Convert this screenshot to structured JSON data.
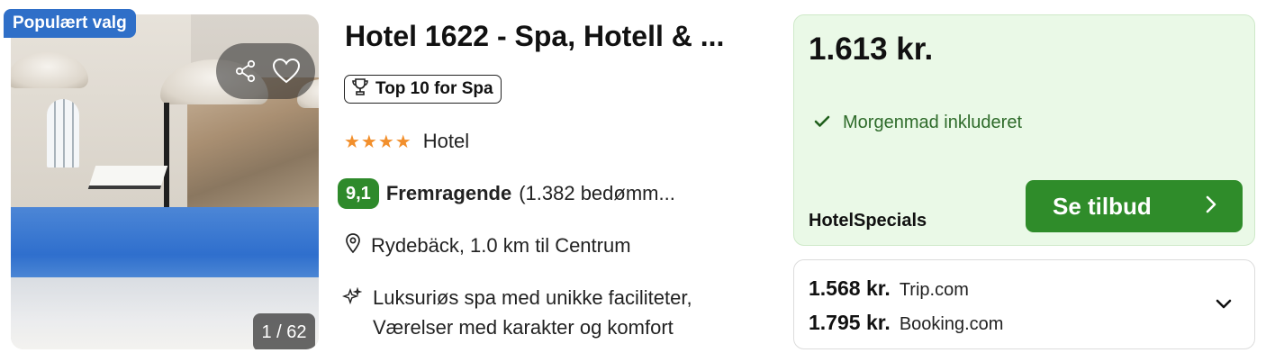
{
  "photo": {
    "badge": "Populært valg",
    "counter": "1 / 62"
  },
  "hotel": {
    "title": "Hotel 1622 - Spa, Hotell & ...",
    "award": "Top 10 for Spa",
    "stars": "★★★★",
    "star_count": 4,
    "type": "Hotel",
    "score": "9,1",
    "rating_word": "Fremragende",
    "reviews": "(1.382 bedømm...",
    "location": "Rydebäck, 1.0 km til Centrum",
    "features_line1": "Luksuriøs spa med unikke faciliteter,",
    "features_line2": "Værelser med karakter og komfort"
  },
  "deal": {
    "price": "1.613 kr.",
    "perk": "Morgenmad inkluderet",
    "provider": "HotelSpecials",
    "cta": "Se tilbud"
  },
  "others": [
    {
      "price": "1.568 kr.",
      "site": "Trip.com"
    },
    {
      "price": "1.795 kr.",
      "site": "Booking.com"
    }
  ],
  "colors": {
    "badge": "#2f6fc8",
    "score": "#2e8a2b",
    "stars": "#f28f2c",
    "deal_bg": "#eaf9e7",
    "cta": "#2f8c2a"
  },
  "icons": {
    "share": "share-icon",
    "favorite": "heart-icon",
    "award": "trophy-icon",
    "location": "pin-icon",
    "features": "sparkle-icon",
    "check": "check-icon",
    "cta_arrow": "chevron-right-icon",
    "expand": "chevron-down-icon"
  }
}
